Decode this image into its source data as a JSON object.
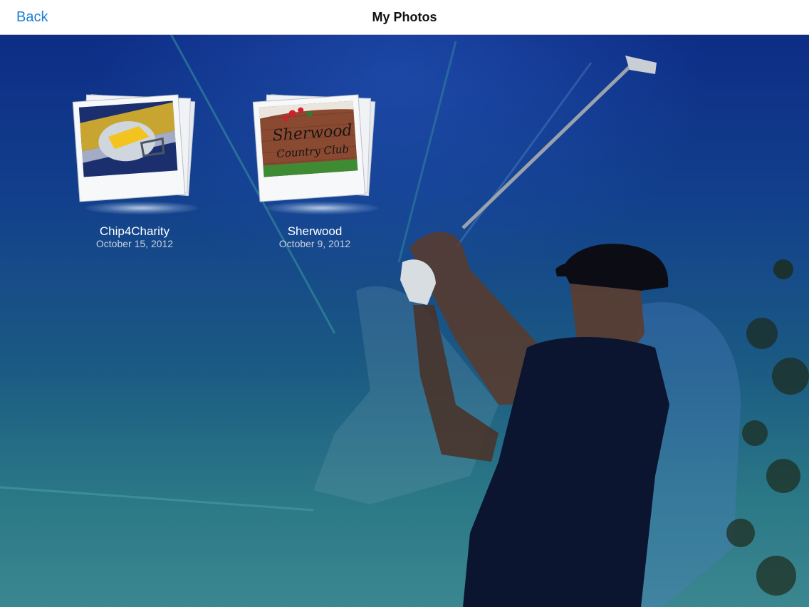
{
  "nav": {
    "back_label": "Back",
    "title": "My Photos"
  },
  "albums": [
    {
      "title": "Chip4Charity",
      "date": "October 15, 2012",
      "thumbnail_icon": "football-helmet-photo"
    },
    {
      "title": "Sherwood",
      "date": "October 9, 2012",
      "thumbnail_icon": "country-club-sign-photo",
      "thumbnail_text": "Sherwood Country Club"
    }
  ],
  "colors": {
    "accent": "#1a7fd6",
    "nav_background": "#ffffff",
    "background_top": "#0d2d86",
    "background_bottom": "#3b8790"
  }
}
